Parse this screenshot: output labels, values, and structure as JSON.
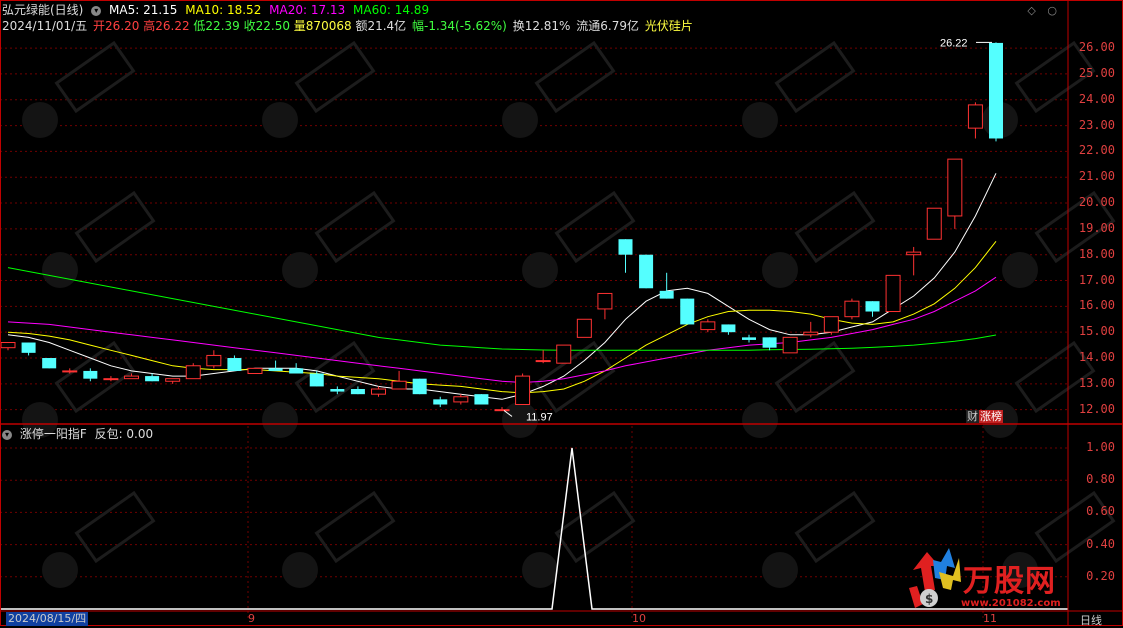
{
  "header": {
    "stock_name": "弘元绿能(日线)",
    "ma5_label": "MA5: 21.15",
    "ma10_label": "MA10: 18.52",
    "ma20_label": "MA20: 17.13",
    "ma60_label": "MA60: 14.89",
    "date": "2024/11/01/五",
    "open": "开26.20",
    "high": "高26.22",
    "low": "低22.39",
    "close": "收22.50",
    "volume": "量870068",
    "amount": "额21.4亿",
    "change": "幅-1.34(-5.62%)",
    "turnover": "换12.81%",
    "float_cap": "流通6.79亿",
    "sector": "光伏硅片"
  },
  "colors": {
    "up": "#ff3232",
    "down": "#54ffff",
    "ma5": "#ffffff",
    "ma10": "#ffff00",
    "ma20": "#ff00ff",
    "ma60": "#00ff00",
    "grid": "#700000",
    "axis": "#c00000",
    "indicator": "#ffffff"
  },
  "price_axis": {
    "ticks": [
      "26.00",
      "25.00",
      "24.00",
      "23.00",
      "22.00",
      "21.00",
      "20.00",
      "19.00",
      "18.00",
      "17.00",
      "16.00",
      "15.00",
      "14.00",
      "13.00",
      "12.00"
    ]
  },
  "annotations": {
    "high_label": "26.22",
    "low_label": "11.97"
  },
  "indicator": {
    "title": "涨停一阳指F",
    "value_label": "反包: 0.00",
    "ticks": [
      "1.00",
      "0.80",
      "0.60",
      "0.40",
      "0.20"
    ],
    "spike_value": 1.0
  },
  "x_axis": {
    "start_date": "2024/08/15/四",
    "labels": [
      "9",
      "10",
      "11"
    ]
  },
  "rank_badge": {
    "left": "财",
    "right": "涨榜"
  },
  "logo": {
    "brand": "万股网",
    "url": "www.201082.com"
  },
  "period_tab": "日线",
  "chart_data": {
    "type": "candlestick",
    "ylim": [
      11.6,
      26.7
    ],
    "candles": [
      {
        "o": 14.4,
        "h": 14.6,
        "l": 14.3,
        "c": 14.6
      },
      {
        "o": 14.6,
        "h": 14.6,
        "l": 14.1,
        "c": 14.2
      },
      {
        "o": 14.0,
        "h": 14.0,
        "l": 13.6,
        "c": 13.6
      },
      {
        "o": 13.5,
        "h": 13.6,
        "l": 13.4,
        "c": 13.5
      },
      {
        "o": 13.5,
        "h": 13.6,
        "l": 13.1,
        "c": 13.2
      },
      {
        "o": 13.2,
        "h": 13.3,
        "l": 13.1,
        "c": 13.2
      },
      {
        "o": 13.2,
        "h": 13.4,
        "l": 13.2,
        "c": 13.3
      },
      {
        "o": 13.3,
        "h": 13.4,
        "l": 13.1,
        "c": 13.1
      },
      {
        "o": 13.1,
        "h": 13.2,
        "l": 13.0,
        "c": 13.2
      },
      {
        "o": 13.2,
        "h": 13.8,
        "l": 13.2,
        "c": 13.7
      },
      {
        "o": 13.7,
        "h": 14.3,
        "l": 13.6,
        "c": 14.1
      },
      {
        "o": 14.0,
        "h": 14.1,
        "l": 13.5,
        "c": 13.5
      },
      {
        "o": 13.4,
        "h": 13.6,
        "l": 13.4,
        "c": 13.6
      },
      {
        "o": 13.6,
        "h": 13.9,
        "l": 13.5,
        "c": 13.5
      },
      {
        "o": 13.6,
        "h": 13.8,
        "l": 13.4,
        "c": 13.4
      },
      {
        "o": 13.4,
        "h": 13.5,
        "l": 12.9,
        "c": 12.9
      },
      {
        "o": 12.8,
        "h": 12.9,
        "l": 12.6,
        "c": 12.7
      },
      {
        "o": 12.8,
        "h": 12.9,
        "l": 12.6,
        "c": 12.6
      },
      {
        "o": 12.6,
        "h": 12.9,
        "l": 12.5,
        "c": 12.8
      },
      {
        "o": 12.8,
        "h": 13.5,
        "l": 12.8,
        "c": 13.1
      },
      {
        "o": 13.2,
        "h": 13.2,
        "l": 12.6,
        "c": 12.6
      },
      {
        "o": 12.4,
        "h": 12.5,
        "l": 12.1,
        "c": 12.2
      },
      {
        "o": 12.3,
        "h": 12.6,
        "l": 12.2,
        "c": 12.5
      },
      {
        "o": 12.6,
        "h": 12.6,
        "l": 12.2,
        "c": 12.2
      },
      {
        "o": 12.0,
        "h": 12.1,
        "l": 11.97,
        "c": 12.0
      },
      {
        "o": 12.2,
        "h": 13.4,
        "l": 12.2,
        "c": 13.3
      },
      {
        "o": 13.9,
        "h": 14.3,
        "l": 13.8,
        "c": 13.9
      },
      {
        "o": 13.8,
        "h": 14.5,
        "l": 13.8,
        "c": 14.5
      },
      {
        "o": 14.8,
        "h": 15.5,
        "l": 14.8,
        "c": 15.5
      },
      {
        "o": 15.9,
        "h": 16.5,
        "l": 15.5,
        "c": 16.5
      },
      {
        "o": 18.6,
        "h": 18.6,
        "l": 17.3,
        "c": 18.0
      },
      {
        "o": 18.0,
        "h": 18.0,
        "l": 16.7,
        "c": 16.7
      },
      {
        "o": 16.6,
        "h": 17.3,
        "l": 16.3,
        "c": 16.3
      },
      {
        "o": 16.3,
        "h": 16.3,
        "l": 15.3,
        "c": 15.3
      },
      {
        "o": 15.1,
        "h": 15.5,
        "l": 15.0,
        "c": 15.4
      },
      {
        "o": 15.3,
        "h": 15.3,
        "l": 14.9,
        "c": 15.0
      },
      {
        "o": 14.8,
        "h": 14.9,
        "l": 14.6,
        "c": 14.7
      },
      {
        "o": 14.8,
        "h": 14.8,
        "l": 14.3,
        "c": 14.4
      },
      {
        "o": 14.2,
        "h": 14.8,
        "l": 14.2,
        "c": 14.8
      },
      {
        "o": 14.9,
        "h": 15.4,
        "l": 14.8,
        "c": 15.0
      },
      {
        "o": 15.0,
        "h": 15.6,
        "l": 14.9,
        "c": 15.6
      },
      {
        "o": 15.6,
        "h": 16.3,
        "l": 15.5,
        "c": 16.2
      },
      {
        "o": 16.2,
        "h": 16.2,
        "l": 15.6,
        "c": 15.8
      },
      {
        "o": 15.8,
        "h": 17.2,
        "l": 15.8,
        "c": 17.2
      },
      {
        "o": 18.0,
        "h": 18.3,
        "l": 17.2,
        "c": 18.1
      },
      {
        "o": 18.6,
        "h": 19.8,
        "l": 18.6,
        "c": 19.8
      },
      {
        "o": 19.5,
        "h": 21.7,
        "l": 19.0,
        "c": 21.7
      },
      {
        "o": 22.9,
        "h": 23.9,
        "l": 22.5,
        "c": 23.8
      },
      {
        "o": 26.2,
        "h": 26.22,
        "l": 22.39,
        "c": 22.5
      }
    ],
    "series": [
      {
        "name": "MA5",
        "values": [
          14.9,
          14.8,
          14.6,
          14.3,
          14.0,
          13.7,
          13.5,
          13.4,
          13.3,
          13.3,
          13.4,
          13.5,
          13.6,
          13.6,
          13.6,
          13.5,
          13.3,
          13.1,
          12.9,
          12.8,
          12.8,
          12.7,
          12.6,
          12.5,
          12.4,
          12.6,
          12.9,
          13.3,
          13.9,
          14.6,
          15.5,
          16.2,
          16.6,
          16.7,
          16.5,
          16.0,
          15.5,
          15.1,
          14.9,
          14.9,
          15.0,
          15.2,
          15.4,
          15.9,
          16.4,
          17.1,
          18.1,
          19.5,
          21.15
        ]
      },
      {
        "name": "MA10",
        "values": [
          15.0,
          14.95,
          14.85,
          14.7,
          14.5,
          14.3,
          14.1,
          13.9,
          13.7,
          13.6,
          13.55,
          13.55,
          13.55,
          13.5,
          13.45,
          13.4,
          13.3,
          13.25,
          13.2,
          13.1,
          13.0,
          12.95,
          12.9,
          12.8,
          12.7,
          12.65,
          12.7,
          12.8,
          13.1,
          13.5,
          14.0,
          14.5,
          14.9,
          15.3,
          15.6,
          15.8,
          15.85,
          15.85,
          15.8,
          15.7,
          15.5,
          15.35,
          15.3,
          15.4,
          15.7,
          16.1,
          16.7,
          17.5,
          18.52
        ]
      },
      {
        "name": "MA20",
        "values": [
          15.4,
          15.35,
          15.3,
          15.2,
          15.1,
          15.0,
          14.9,
          14.8,
          14.7,
          14.6,
          14.5,
          14.4,
          14.3,
          14.2,
          14.1,
          14.0,
          13.9,
          13.8,
          13.7,
          13.6,
          13.5,
          13.4,
          13.3,
          13.2,
          13.1,
          13.05,
          13.1,
          13.2,
          13.35,
          13.5,
          13.7,
          13.85,
          14.0,
          14.15,
          14.3,
          14.4,
          14.5,
          14.55,
          14.6,
          14.7,
          14.8,
          14.95,
          15.1,
          15.3,
          15.5,
          15.8,
          16.2,
          16.6,
          17.13
        ]
      },
      {
        "name": "MA60",
        "values": [
          17.5,
          17.35,
          17.2,
          17.05,
          16.9,
          16.75,
          16.6,
          16.45,
          16.3,
          16.15,
          16.0,
          15.85,
          15.7,
          15.55,
          15.4,
          15.25,
          15.1,
          14.95,
          14.8,
          14.7,
          14.6,
          14.5,
          14.45,
          14.4,
          14.35,
          14.33,
          14.31,
          14.3,
          14.3,
          14.3,
          14.3,
          14.3,
          14.3,
          14.3,
          14.3,
          14.3,
          14.3,
          14.32,
          14.33,
          14.34,
          14.36,
          14.38,
          14.41,
          14.45,
          14.5,
          14.57,
          14.65,
          14.75,
          14.89
        ]
      }
    ]
  }
}
